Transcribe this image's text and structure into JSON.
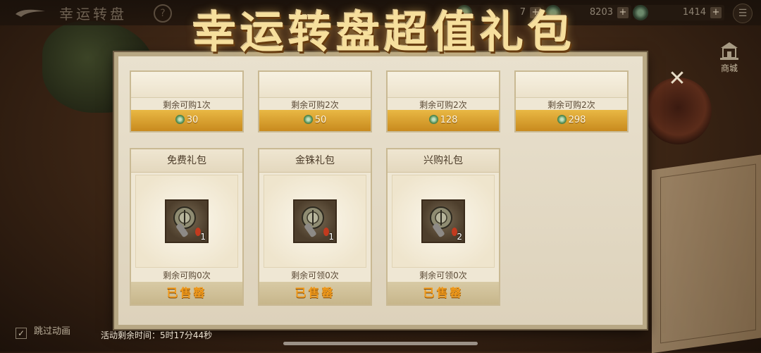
{
  "topbar": {
    "title": "幸运转盘",
    "help": "?",
    "resources": [
      {
        "value": "7",
        "plus": "+"
      },
      {
        "value": "8203",
        "plus": "+"
      },
      {
        "value": "1414",
        "plus": "+"
      }
    ],
    "menu": "☰"
  },
  "banner": "幸运转盘超值礼包",
  "shop": {
    "label": "商城",
    "icon": "shop-building-icon"
  },
  "close": "✕",
  "top_cards": [
    {
      "remain": "剩余可购1次",
      "price": "30"
    },
    {
      "remain": "剩余可购2次",
      "price": "50"
    },
    {
      "remain": "剩余可购2次",
      "price": "128"
    },
    {
      "remain": "剩余可购2次",
      "price": "298"
    }
  ],
  "packs": [
    {
      "title": "免费礼包",
      "count": "1",
      "remain": "剩余可购0次",
      "status": "已售罄"
    },
    {
      "title": "金铢礼包",
      "count": "1",
      "remain": "剩余可领0次",
      "status": "已售罄"
    },
    {
      "title": "兴购礼包",
      "count": "2",
      "remain": "剩余可领0次",
      "status": "已售罄"
    }
  ],
  "footer": {
    "skip_label": "跳过动画",
    "skip_checked": "✓",
    "timer": "活动剩余时间：5时17分44秒"
  },
  "colors": {
    "gold": "#e9b844",
    "soldout": "#f29a1a",
    "panel": "#e9e1ce"
  }
}
